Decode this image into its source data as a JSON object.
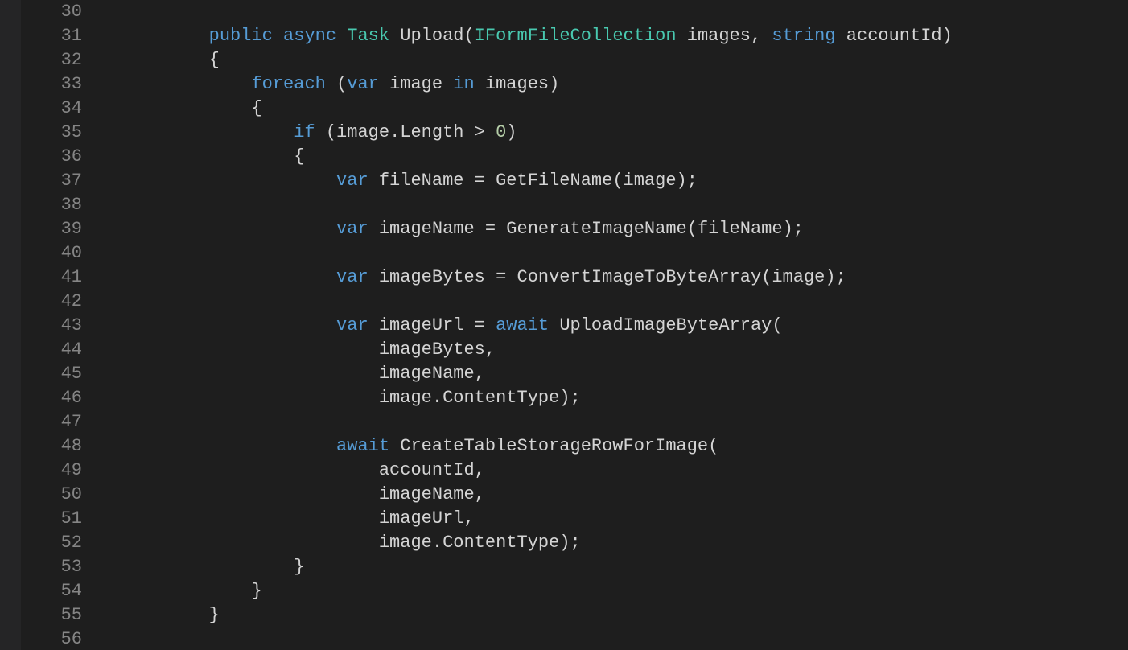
{
  "gutter": {
    "start": 30,
    "end": 56
  },
  "tokens": {
    "kw_public": "public",
    "kw_async": "async",
    "kw_foreach": "foreach",
    "kw_var": "var",
    "kw_if": "if",
    "kw_in": "in",
    "kw_await": "await",
    "kw_string": "string",
    "type_Task": "Task",
    "type_IFormFileCollection": "IFormFileCollection",
    "fn_Upload": "Upload",
    "fn_GetFileName": "GetFileName",
    "fn_GenerateImageName": "GenerateImageName",
    "fn_ConvertImageToByteArray": "ConvertImageToByteArray",
    "fn_UploadImageByteArray": "UploadImageByteArray",
    "fn_CreateTableStorageRowForImage": "CreateTableStorageRowForImage",
    "id_images": "images",
    "id_image": "image",
    "id_accountId": "accountId",
    "id_Length": "Length",
    "id_fileName": "fileName",
    "id_imageName": "imageName",
    "id_imageBytes": "imageBytes",
    "id_imageUrl": "imageUrl",
    "id_ContentType": "ContentType",
    "num_zero": "0",
    "p_oparen": "(",
    "p_cparen": ")",
    "p_obrace": "{",
    "p_cbrace": "}",
    "p_comma": ",",
    "p_semi": ";",
    "p_dot": ".",
    "p_gt": ">",
    "p_eq": "=",
    "p_sp": " "
  },
  "code_lines": [
    {
      "n": 30,
      "indent": 0,
      "t": []
    },
    {
      "n": 31,
      "indent": 8,
      "t": [
        [
          "kw",
          "kw_public"
        ],
        [
          "sp"
        ],
        [
          "kw",
          "kw_async"
        ],
        [
          "sp"
        ],
        [
          "type",
          "type_Task"
        ],
        [
          "sp"
        ],
        [
          "id",
          "fn_Upload"
        ],
        [
          "pn",
          "p_oparen"
        ],
        [
          "type",
          "type_IFormFileCollection"
        ],
        [
          "sp"
        ],
        [
          "id",
          "id_images"
        ],
        [
          "pn",
          "p_comma"
        ],
        [
          "sp"
        ],
        [
          "kw",
          "kw_string"
        ],
        [
          "sp"
        ],
        [
          "id",
          "id_accountId"
        ],
        [
          "pn",
          "p_cparen"
        ]
      ]
    },
    {
      "n": 32,
      "indent": 8,
      "t": [
        [
          "pn",
          "p_obrace"
        ]
      ]
    },
    {
      "n": 33,
      "indent": 12,
      "t": [
        [
          "kw",
          "kw_foreach"
        ],
        [
          "sp"
        ],
        [
          "pn",
          "p_oparen"
        ],
        [
          "kw",
          "kw_var"
        ],
        [
          "sp"
        ],
        [
          "id",
          "id_image"
        ],
        [
          "sp"
        ],
        [
          "kw",
          "kw_in"
        ],
        [
          "sp"
        ],
        [
          "id",
          "id_images"
        ],
        [
          "pn",
          "p_cparen"
        ]
      ]
    },
    {
      "n": 34,
      "indent": 12,
      "t": [
        [
          "pn",
          "p_obrace"
        ]
      ]
    },
    {
      "n": 35,
      "indent": 16,
      "t": [
        [
          "kw",
          "kw_if"
        ],
        [
          "sp"
        ],
        [
          "pn",
          "p_oparen"
        ],
        [
          "id",
          "id_image"
        ],
        [
          "pn",
          "p_dot"
        ],
        [
          "id",
          "id_Length"
        ],
        [
          "sp"
        ],
        [
          "pn",
          "p_gt"
        ],
        [
          "sp"
        ],
        [
          "num",
          "num_zero"
        ],
        [
          "pn",
          "p_cparen"
        ]
      ]
    },
    {
      "n": 36,
      "indent": 16,
      "t": [
        [
          "pn",
          "p_obrace"
        ]
      ]
    },
    {
      "n": 37,
      "indent": 20,
      "t": [
        [
          "kw",
          "kw_var"
        ],
        [
          "sp"
        ],
        [
          "id",
          "id_fileName"
        ],
        [
          "sp"
        ],
        [
          "pn",
          "p_eq"
        ],
        [
          "sp"
        ],
        [
          "id",
          "fn_GetFileName"
        ],
        [
          "pn",
          "p_oparen"
        ],
        [
          "id",
          "id_image"
        ],
        [
          "pn",
          "p_cparen"
        ],
        [
          "pn",
          "p_semi"
        ]
      ]
    },
    {
      "n": 38,
      "indent": 0,
      "t": []
    },
    {
      "n": 39,
      "indent": 20,
      "t": [
        [
          "kw",
          "kw_var"
        ],
        [
          "sp"
        ],
        [
          "id",
          "id_imageName"
        ],
        [
          "sp"
        ],
        [
          "pn",
          "p_eq"
        ],
        [
          "sp"
        ],
        [
          "id",
          "fn_GenerateImageName"
        ],
        [
          "pn",
          "p_oparen"
        ],
        [
          "id",
          "id_fileName"
        ],
        [
          "pn",
          "p_cparen"
        ],
        [
          "pn",
          "p_semi"
        ]
      ]
    },
    {
      "n": 40,
      "indent": 0,
      "t": []
    },
    {
      "n": 41,
      "indent": 20,
      "t": [
        [
          "kw",
          "kw_var"
        ],
        [
          "sp"
        ],
        [
          "id",
          "id_imageBytes"
        ],
        [
          "sp"
        ],
        [
          "pn",
          "p_eq"
        ],
        [
          "sp"
        ],
        [
          "id",
          "fn_ConvertImageToByteArray"
        ],
        [
          "pn",
          "p_oparen"
        ],
        [
          "id",
          "id_image"
        ],
        [
          "pn",
          "p_cparen"
        ],
        [
          "pn",
          "p_semi"
        ]
      ]
    },
    {
      "n": 42,
      "indent": 0,
      "t": []
    },
    {
      "n": 43,
      "indent": 20,
      "t": [
        [
          "kw",
          "kw_var"
        ],
        [
          "sp"
        ],
        [
          "id",
          "id_imageUrl"
        ],
        [
          "sp"
        ],
        [
          "pn",
          "p_eq"
        ],
        [
          "sp"
        ],
        [
          "kw",
          "kw_await"
        ],
        [
          "sp"
        ],
        [
          "id",
          "fn_UploadImageByteArray"
        ],
        [
          "pn",
          "p_oparen"
        ]
      ]
    },
    {
      "n": 44,
      "indent": 24,
      "t": [
        [
          "id",
          "id_imageBytes"
        ],
        [
          "pn",
          "p_comma"
        ]
      ]
    },
    {
      "n": 45,
      "indent": 24,
      "t": [
        [
          "id",
          "id_imageName"
        ],
        [
          "pn",
          "p_comma"
        ]
      ]
    },
    {
      "n": 46,
      "indent": 24,
      "t": [
        [
          "id",
          "id_image"
        ],
        [
          "pn",
          "p_dot"
        ],
        [
          "id",
          "id_ContentType"
        ],
        [
          "pn",
          "p_cparen"
        ],
        [
          "pn",
          "p_semi"
        ]
      ]
    },
    {
      "n": 47,
      "indent": 0,
      "t": []
    },
    {
      "n": 48,
      "indent": 20,
      "t": [
        [
          "kw",
          "kw_await"
        ],
        [
          "sp"
        ],
        [
          "id",
          "fn_CreateTableStorageRowForImage"
        ],
        [
          "pn",
          "p_oparen"
        ]
      ]
    },
    {
      "n": 49,
      "indent": 24,
      "t": [
        [
          "id",
          "id_accountId"
        ],
        [
          "pn",
          "p_comma"
        ]
      ]
    },
    {
      "n": 50,
      "indent": 24,
      "t": [
        [
          "id",
          "id_imageName"
        ],
        [
          "pn",
          "p_comma"
        ]
      ]
    },
    {
      "n": 51,
      "indent": 24,
      "t": [
        [
          "id",
          "id_imageUrl"
        ],
        [
          "pn",
          "p_comma"
        ]
      ]
    },
    {
      "n": 52,
      "indent": 24,
      "t": [
        [
          "id",
          "id_image"
        ],
        [
          "pn",
          "p_dot"
        ],
        [
          "id",
          "id_ContentType"
        ],
        [
          "pn",
          "p_cparen"
        ],
        [
          "pn",
          "p_semi"
        ]
      ]
    },
    {
      "n": 53,
      "indent": 16,
      "t": [
        [
          "pn",
          "p_cbrace"
        ]
      ]
    },
    {
      "n": 54,
      "indent": 12,
      "t": [
        [
          "pn",
          "p_cbrace"
        ]
      ]
    },
    {
      "n": 55,
      "indent": 8,
      "t": [
        [
          "pn",
          "p_cbrace"
        ]
      ]
    },
    {
      "n": 56,
      "indent": 0,
      "t": []
    }
  ]
}
